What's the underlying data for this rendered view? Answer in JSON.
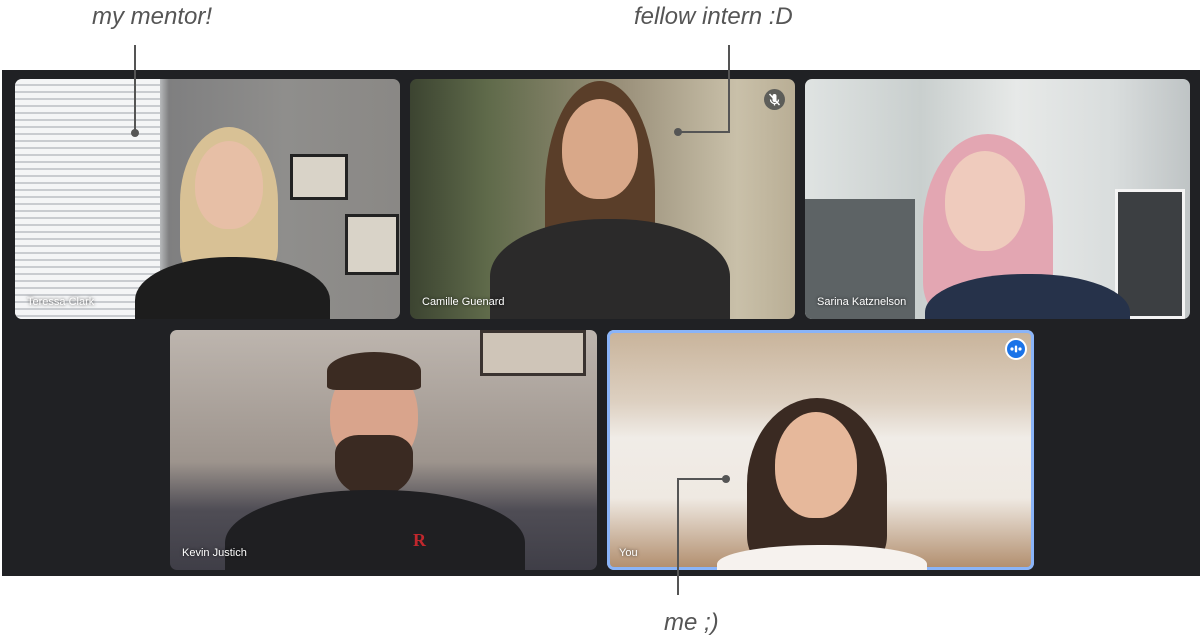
{
  "annotations": {
    "mentor": "my mentor!",
    "intern": "fellow intern :D",
    "me": "me ;)"
  },
  "participants": [
    {
      "name": "Teressa Clark",
      "muted": false
    },
    {
      "name": "Camille Guenard",
      "muted": true
    },
    {
      "name": "Sarina Katznelson",
      "muted": false
    },
    {
      "name": "Kevin Justich",
      "muted": false
    },
    {
      "name": "You",
      "muted": false,
      "speaking": true
    }
  ],
  "icons": {
    "muted": "mic-off-icon",
    "speaking": "audio-levels-icon"
  },
  "colors": {
    "stage_background": "#202124",
    "active_speaker_border": "#8ab4f8",
    "speaking_indicator": "#1a73e8",
    "annotation_text": "#555555"
  }
}
